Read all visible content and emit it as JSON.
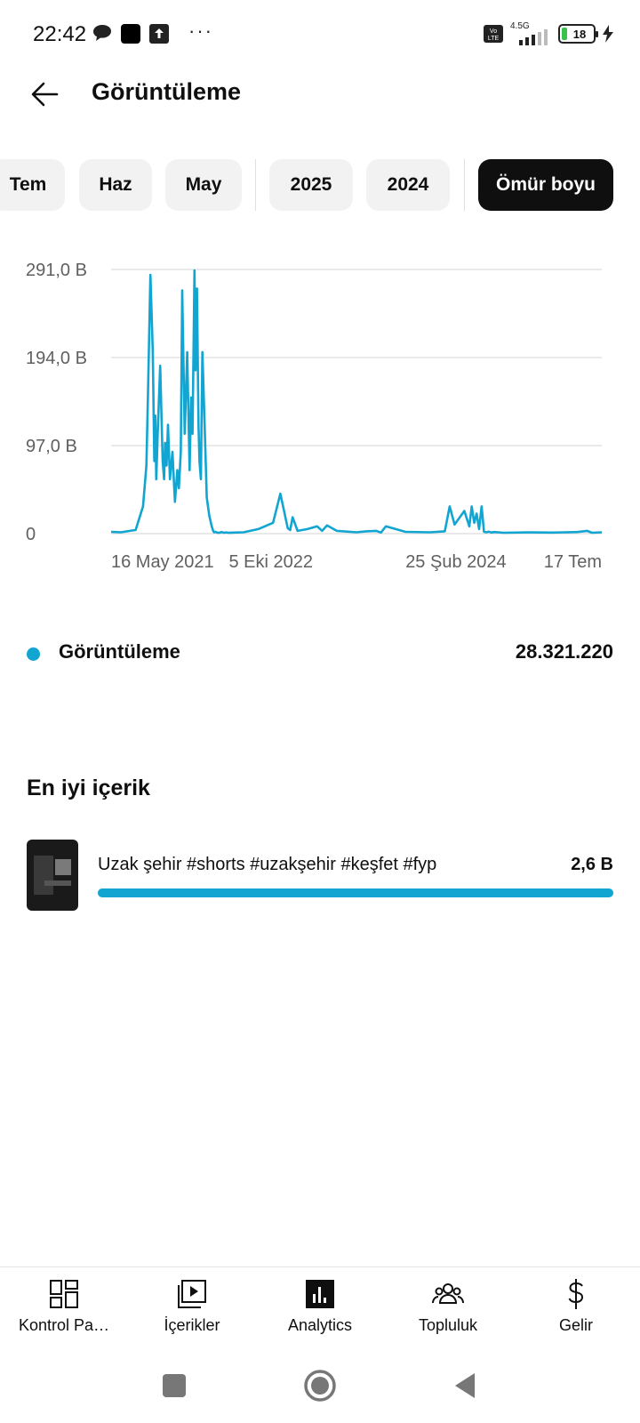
{
  "status_bar": {
    "time": "22:42",
    "network": "4.5G",
    "volte": "Vo LTE",
    "battery": "18",
    "icons": [
      "chat-bubble-icon",
      "app-square-icon",
      "upload-icon",
      "more-dots-icon",
      "signal-icon",
      "battery-icon",
      "charging-icon"
    ]
  },
  "header": {
    "title": "Görüntüleme",
    "back_icon": "arrow-left-icon"
  },
  "chips": [
    {
      "label": "Tem",
      "selected": false
    },
    {
      "label": "Haz",
      "selected": false
    },
    {
      "label": "May",
      "selected": false
    },
    {
      "label": "2025",
      "selected": false
    },
    {
      "label": "2024",
      "selected": false
    },
    {
      "label": "Ömür boyu",
      "selected": true
    }
  ],
  "chart_data": {
    "type": "line",
    "title": "",
    "xlabel": "",
    "ylabel": "",
    "ylim": [
      0,
      291000
    ],
    "y_ticks": [
      "291,0 B",
      "194,0 B",
      "97,0 B",
      "0"
    ],
    "y_tick_values": [
      291000,
      194000,
      97000,
      0
    ],
    "x_ticks": [
      "16 May 2021",
      "5 Eki 2022",
      "25 Şub 2024",
      "17 Tem"
    ],
    "x_tick_positions": [
      0.0,
      0.24,
      0.6,
      1.0
    ],
    "grid": true,
    "color": "#12a5d1",
    "series": [
      {
        "name": "Görüntüleme",
        "x": [
          0,
          0.02,
          0.05,
          0.065,
          0.072,
          0.075,
          0.08,
          0.085,
          0.088,
          0.09,
          0.092,
          0.095,
          0.1,
          0.105,
          0.108,
          0.11,
          0.113,
          0.116,
          0.12,
          0.125,
          0.13,
          0.135,
          0.138,
          0.142,
          0.145,
          0.15,
          0.155,
          0.16,
          0.163,
          0.166,
          0.17,
          0.172,
          0.175,
          0.178,
          0.18,
          0.183,
          0.186,
          0.19,
          0.195,
          0.2,
          0.205,
          0.208,
          0.21,
          0.213,
          0.216,
          0.22,
          0.225,
          0.23,
          0.235,
          0.24,
          0.25,
          0.27,
          0.3,
          0.33,
          0.345,
          0.36,
          0.365,
          0.37,
          0.38,
          0.4,
          0.42,
          0.43,
          0.44,
          0.46,
          0.5,
          0.52,
          0.54,
          0.55,
          0.56,
          0.6,
          0.65,
          0.68,
          0.69,
          0.7,
          0.72,
          0.73,
          0.735,
          0.74,
          0.745,
          0.75,
          0.755,
          0.76,
          0.765,
          0.77,
          0.775,
          0.78,
          0.8,
          0.85,
          0.9,
          0.95,
          0.97,
          0.98,
          1.0
        ],
        "values": [
          2000,
          1500,
          4000,
          30000,
          75000,
          150000,
          285000,
          200000,
          80000,
          130000,
          60000,
          110000,
          185000,
          80000,
          60000,
          100000,
          75000,
          120000,
          60000,
          90000,
          35000,
          70000,
          50000,
          90000,
          268000,
          110000,
          200000,
          70000,
          150000,
          110000,
          290000,
          180000,
          270000,
          120000,
          80000,
          60000,
          200000,
          130000,
          40000,
          20000,
          8000,
          3000,
          1500,
          2000,
          1200,
          900,
          1800,
          1000,
          1400,
          900,
          1200,
          1500,
          5000,
          12000,
          44000,
          6000,
          4000,
          18000,
          3000,
          5000,
          8000,
          3000,
          9000,
          3000,
          1500,
          2500,
          3000,
          1200,
          8000,
          2000,
          1500,
          2500,
          30000,
          10000,
          25000,
          8000,
          30000,
          12000,
          22000,
          5000,
          30000,
          2000,
          1500,
          2200,
          1200,
          1800,
          1000,
          1400,
          1200,
          1800,
          3000,
          1000,
          1500
        ]
      }
    ]
  },
  "legend": {
    "name": "Görüntüleme",
    "value": "28.321.220",
    "color": "#12a5d1"
  },
  "top_content": {
    "section_title": "En iyi içerik",
    "items": [
      {
        "title": "Uzak şehir #shorts #uzakşehir #keşfet #fyp",
        "value": "2,6 B",
        "progress": 1.0
      }
    ]
  },
  "bottom_nav": [
    {
      "label": "Kontrol Pa…",
      "icon": "dashboard-icon"
    },
    {
      "label": "İçerikler",
      "icon": "content-play-icon"
    },
    {
      "label": "Analytics",
      "icon": "analytics-icon"
    },
    {
      "label": "Topluluk",
      "icon": "community-icon"
    },
    {
      "label": "Gelir",
      "icon": "dollar-icon"
    }
  ],
  "system_nav": [
    "recents-square-icon",
    "home-circle-icon",
    "back-triangle-icon"
  ]
}
